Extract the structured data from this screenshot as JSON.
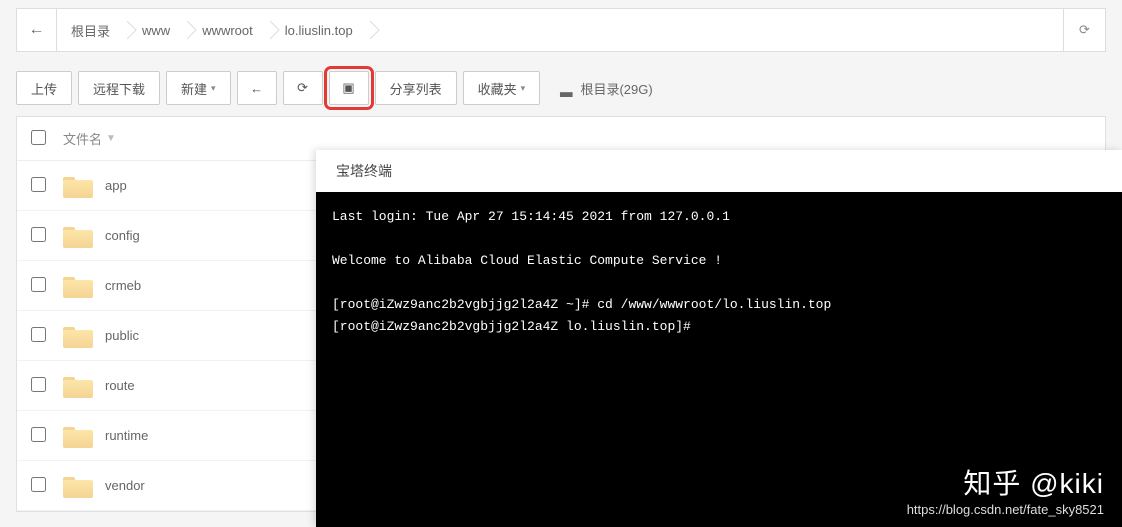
{
  "breadcrumb": {
    "items": [
      "根目录",
      "www",
      "wwwroot",
      "lo.liuslin.top"
    ]
  },
  "toolbar": {
    "upload": "上传",
    "remote_dl": "远程下载",
    "new": "新建",
    "share_list": "分享列表",
    "favorites": "收藏夹",
    "disk_label": "根目录(29G)"
  },
  "file_table": {
    "col_name": "文件名",
    "rows": [
      {
        "name": "app"
      },
      {
        "name": "config"
      },
      {
        "name": "crmeb"
      },
      {
        "name": "public"
      },
      {
        "name": "route"
      },
      {
        "name": "runtime"
      },
      {
        "name": "vendor"
      }
    ]
  },
  "terminal": {
    "title": "宝塔终端",
    "lines": "Last login: Tue Apr 27 15:14:45 2021 from 127.0.0.1\n\nWelcome to Alibaba Cloud Elastic Compute Service !\n\n[root@iZwz9anc2b2vgbjjg2l2a4Z ~]# cd /www/wwwroot/lo.liuslin.top\n[root@iZwz9anc2b2vgbjjg2l2a4Z lo.liuslin.top]# "
  },
  "watermark": {
    "title": "知乎 @kiki",
    "url": "https://blog.csdn.net/fate_sky8521"
  }
}
